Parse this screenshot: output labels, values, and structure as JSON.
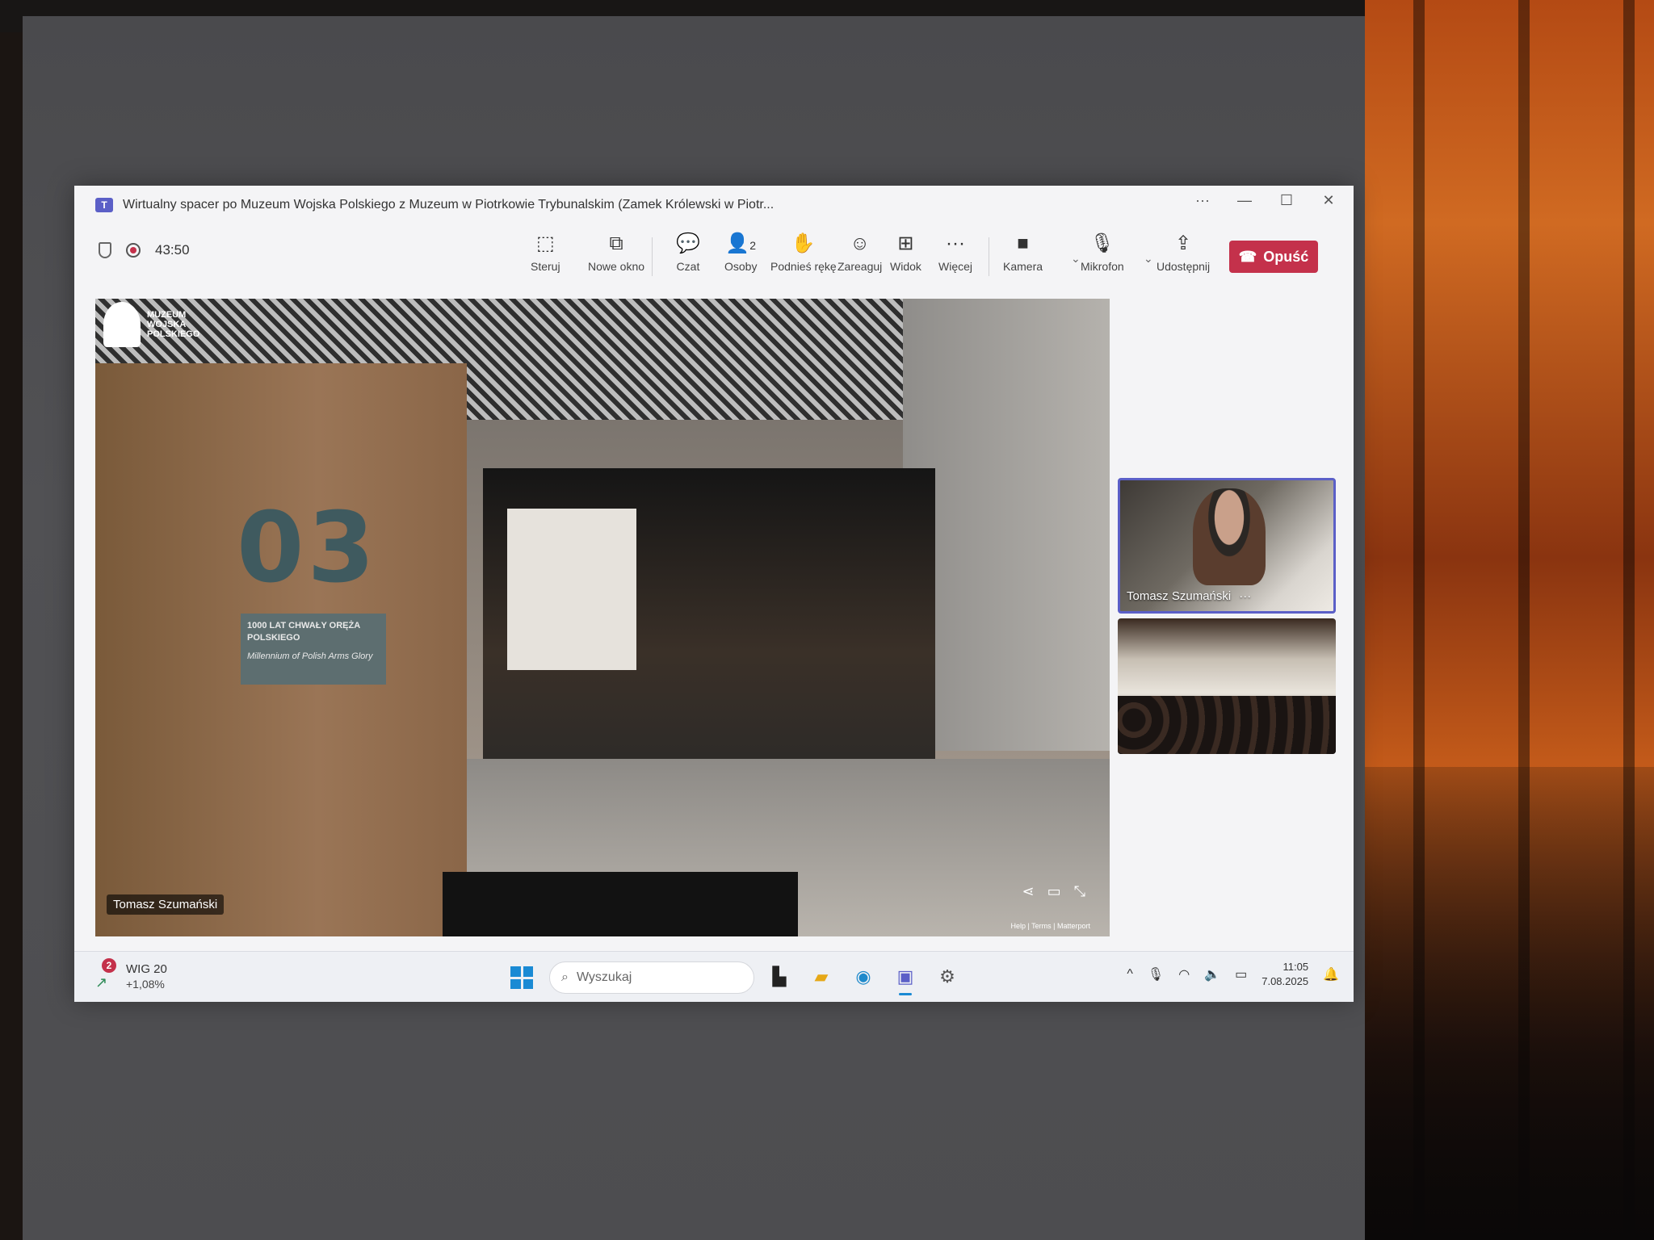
{
  "window": {
    "title": "Wirtualny spacer po Muzeum Wojska Polskiego z Muzeum w Piotrkowie Trybunalskim (Zamek Królewski w Piotr...",
    "controls": [
      "···",
      "—",
      "☐",
      "✕"
    ]
  },
  "meeting": {
    "timer": "43:50",
    "toolbar": [
      {
        "key": "sterui",
        "label": "Steruj",
        "icon": "share-screen-control-icon"
      },
      {
        "key": "nowe",
        "label": "Nowe okno",
        "icon": "pop-out-icon"
      },
      {
        "key": "czat",
        "label": "Czat",
        "icon": "chat-icon"
      },
      {
        "key": "osoby",
        "label": "Osoby",
        "icon": "people-icon",
        "count": "2"
      },
      {
        "key": "reka",
        "label": "Podnieś rękę",
        "icon": "raise-hand-icon"
      },
      {
        "key": "reaguj",
        "label": "Zareaguj",
        "icon": "react-icon"
      },
      {
        "key": "widok",
        "label": "Widok",
        "icon": "view-icon"
      },
      {
        "key": "wiecej",
        "label": "Więcej",
        "icon": "more-icon"
      },
      {
        "key": "kamera",
        "label": "Kamera",
        "icon": "camera-icon"
      },
      {
        "key": "mikrofon",
        "label": "Mikrofon",
        "icon": "microphone-icon"
      },
      {
        "key": "udostepnij",
        "label": "Udostępnij",
        "icon": "share-icon"
      }
    ],
    "leave_label": "Opuść"
  },
  "content": {
    "museum_logo_lines": [
      "MUZEUM",
      "WOJSKA",
      "POLSKIEGO"
    ],
    "section_number": "03",
    "plaque_title": "1000 LAT CHWAŁY ORĘŻA POLSKIEGO",
    "plaque_subtitle": "Millennium of Polish Arms Glory",
    "footer_links": "Help | Terms | Matterport",
    "presenter_tag": "Tomasz Szumański"
  },
  "participants": [
    {
      "name": "Tomasz Szumański",
      "more": "···"
    },
    {
      "name": ""
    }
  ],
  "taskbar": {
    "stock_badge": "2",
    "stock_name": "WIG 20",
    "stock_change": "+1,08%",
    "search_placeholder": "Wyszukaj",
    "time": "11:05",
    "date": "7.08.2025"
  }
}
